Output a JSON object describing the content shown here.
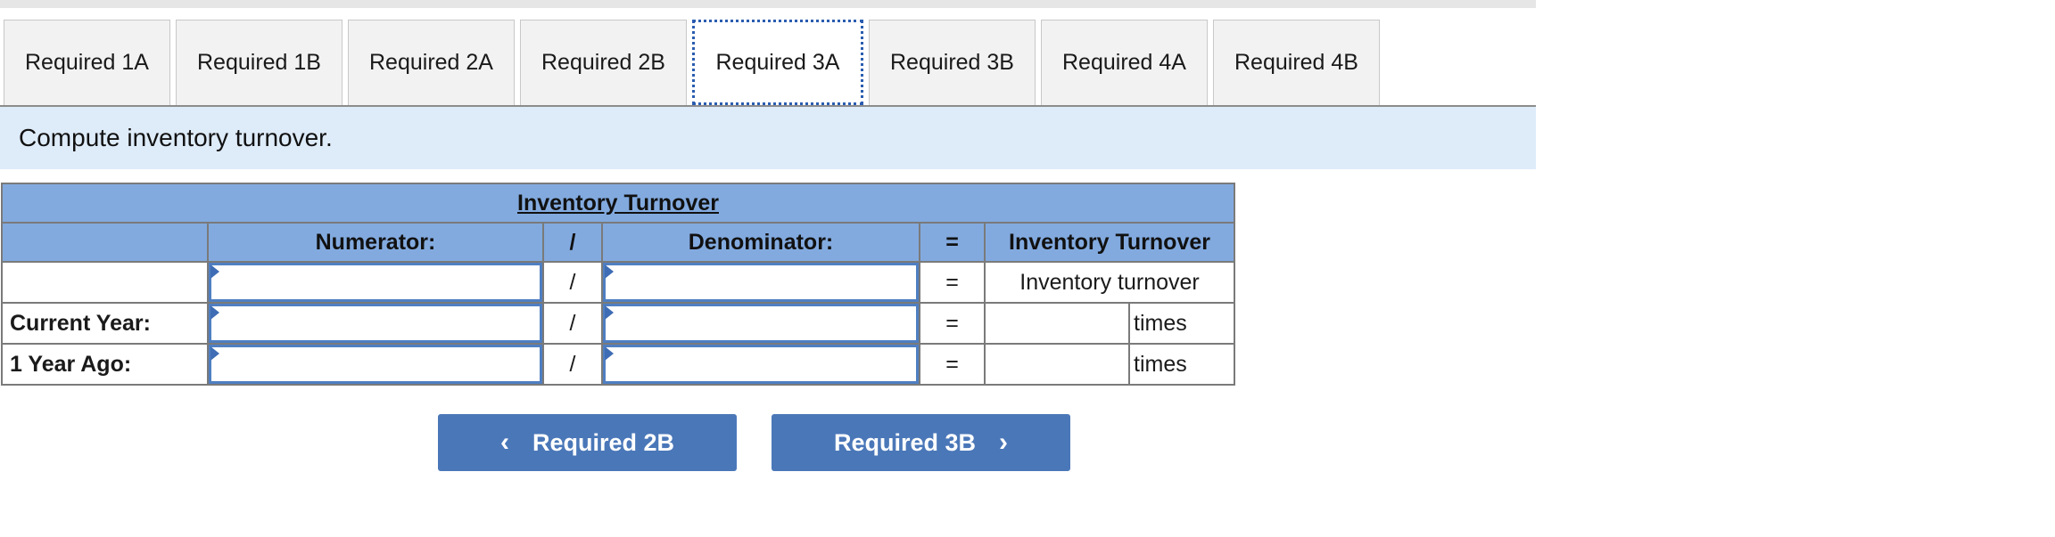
{
  "tabs": [
    {
      "label": "Required 1A",
      "active": false
    },
    {
      "label": "Required 1B",
      "active": false
    },
    {
      "label": "Required 2A",
      "active": false
    },
    {
      "label": "Required 2B",
      "active": false
    },
    {
      "label": "Required 3A",
      "active": true
    },
    {
      "label": "Required 3B",
      "active": false
    },
    {
      "label": "Required 4A",
      "active": false
    },
    {
      "label": "Required 4B",
      "active": false
    }
  ],
  "instruction": "Compute inventory turnover.",
  "table": {
    "title": "Inventory Turnover",
    "headers": {
      "numerator": "Numerator:",
      "divide": "/",
      "denominator": "Denominator:",
      "equals": "=",
      "result": "Inventory Turnover"
    },
    "rows": [
      {
        "label": "",
        "numerator": "",
        "divide": "/",
        "denominator": "",
        "equals": "=",
        "result": "Inventory turnover",
        "unit": ""
      },
      {
        "label": "Current Year:",
        "numerator": "",
        "divide": "/",
        "denominator": "",
        "equals": "=",
        "result": "",
        "unit": "times"
      },
      {
        "label": "1 Year Ago:",
        "numerator": "",
        "divide": "/",
        "denominator": "",
        "equals": "=",
        "result": "",
        "unit": "times"
      }
    ]
  },
  "nav": {
    "prev_label": "Required 2B",
    "prev_icon": "chevron-left-icon",
    "prev_glyph": "‹",
    "next_label": "Required 3B",
    "next_icon": "chevron-right-icon",
    "next_glyph": "›"
  },
  "colors": {
    "header_bg": "#82aadf",
    "banner_bg": "#deebf9",
    "button_bg": "#4a77b8",
    "active_tab_border": "#2a5db0"
  }
}
